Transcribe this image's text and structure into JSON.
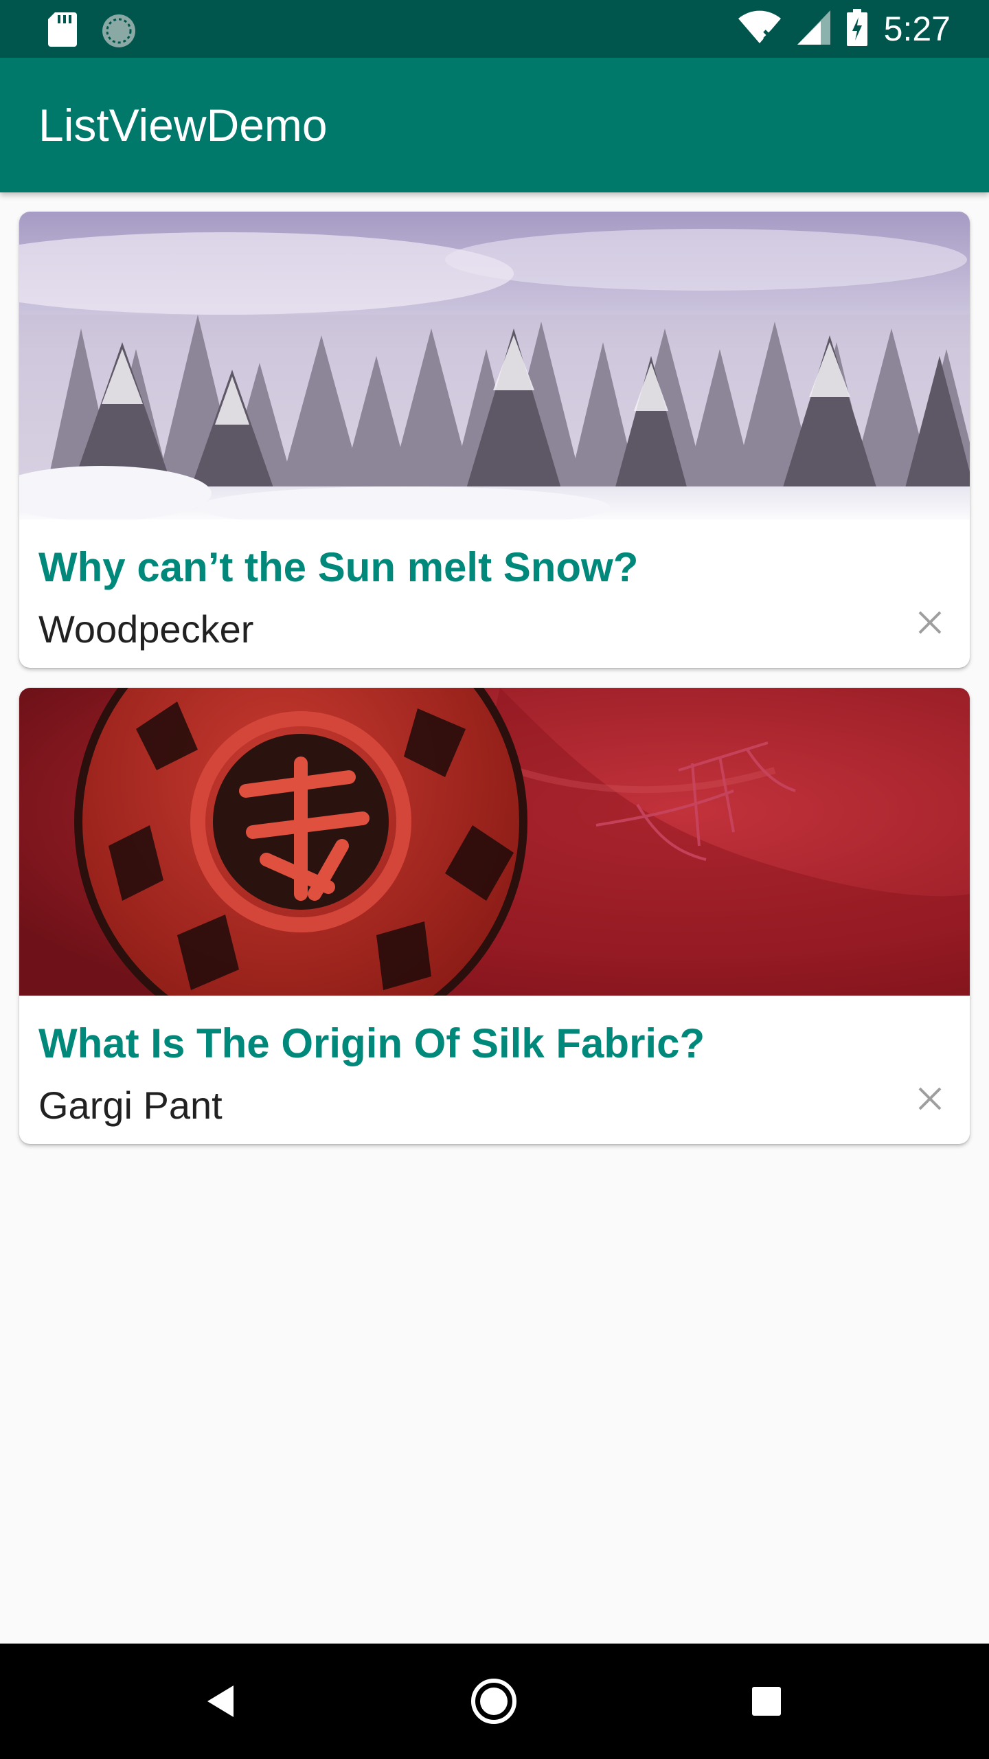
{
  "status_bar": {
    "time": "5:27",
    "icons": [
      "sd-card-icon",
      "sync-icon",
      "wifi-icon",
      "signal-icon",
      "battery-charging-icon"
    ]
  },
  "app_bar": {
    "title": "ListViewDemo"
  },
  "cards": [
    {
      "title": "Why can’t the Sun melt Snow?",
      "author": "Woodpecker",
      "image": "snowy-forest-image",
      "close_icon": "close-icon"
    },
    {
      "title": "What Is The Origin Of Silk Fabric?",
      "author": "Gargi Pant",
      "image": "red-lacquer-medallion-image",
      "close_icon": "close-icon"
    }
  ],
  "nav_bar": {
    "icons": [
      "back-icon",
      "home-icon",
      "recents-icon"
    ]
  },
  "colors": {
    "status_bar": "#00564d",
    "app_bar": "#00796b",
    "accent_title": "#00897b",
    "background": "#fafafa"
  }
}
